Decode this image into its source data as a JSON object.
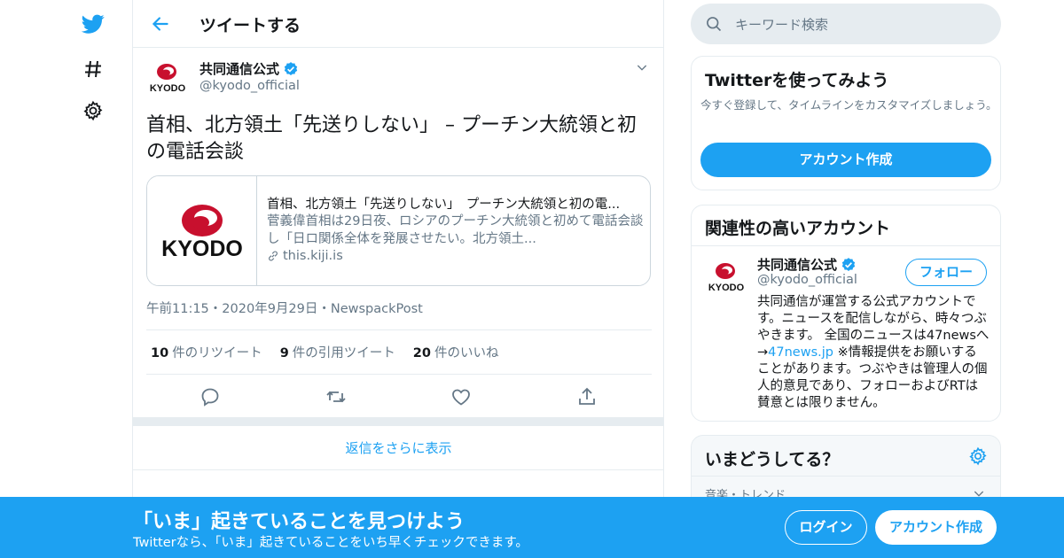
{
  "colors": {
    "accent": "#1da1f2",
    "text": "#14171a",
    "muted": "#657786",
    "border": "#e6ecf0"
  },
  "nav": {
    "icons": [
      "twitter-bird-icon",
      "hashtag-icon",
      "gear-icon"
    ]
  },
  "header": {
    "title": "ツイートする"
  },
  "tweet": {
    "author_name": "共同通信公式",
    "author_handle": "@kyodo_official",
    "avatar_text": "KYODO",
    "text": "首相、北方領土「先送りしない」 – プーチン大統領と初の電話会談",
    "card": {
      "image_text": "KYODO",
      "title": "首相、北方領土「先送りしない」　プーチン大統領と初の電...",
      "description": "菅義偉首相は29日夜、ロシアのプーチン大統領と初めて電話会談し「日ロ関係全体を発展させたい。北方領土...",
      "domain": "this.kiji.is"
    },
    "meta": "午前11:15・2020年9月29日・NewspackPost",
    "stats": [
      {
        "count": "10",
        "label": "件のリツイート"
      },
      {
        "count": "9",
        "label": "件の引用ツイート"
      },
      {
        "count": "20",
        "label": "件のいいね"
      }
    ],
    "more_replies": "返信をさらに表示"
  },
  "search": {
    "placeholder": "キーワード検索"
  },
  "signup": {
    "title": "Twitterを使ってみよう",
    "description": "今すぐ登録して、タイムラインをカスタマイズしましょう。",
    "button": "アカウント作成"
  },
  "related": {
    "title": "関連性の高いアカウント",
    "name": "共同通信公式",
    "handle": "@kyodo_official",
    "follow": "フォロー",
    "bio_before": "共同通信が運営する公式アカウントです。ニュースを配信しながら、時々つぶやきます。 全国のニュースは47newsへ →",
    "bio_link": "47news.jp",
    "bio_after": " ※情報提供をお願いすることがあります。つぶやきは管理人の個人的意見であり、フォローおよびRTは賛意とは限りません。"
  },
  "trends": {
    "title": "いまどうしてる？",
    "first_meta": "音楽・トレンド"
  },
  "banner": {
    "headline": "「いま」起きていることを見つけよう",
    "sub": "Twitterなら、「いま」起きていることをいち早くチェックできます。",
    "login": "ログイン",
    "create": "アカウント作成"
  }
}
